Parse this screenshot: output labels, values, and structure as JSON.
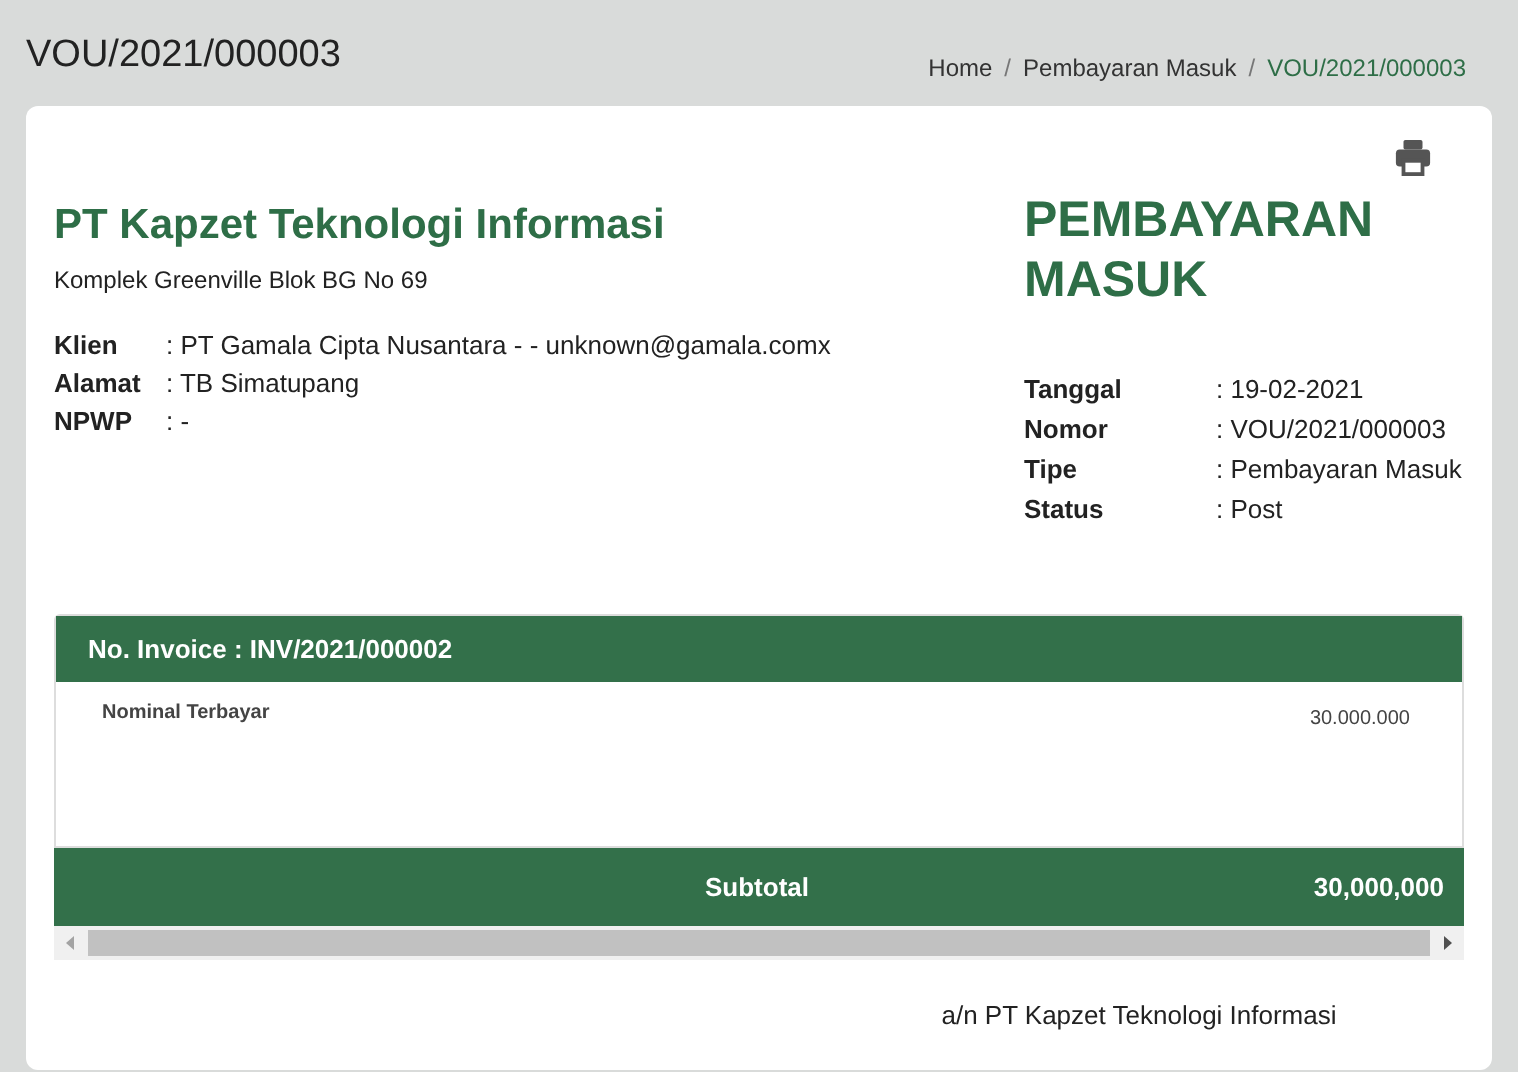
{
  "page_title": "VOU/2021/000003",
  "breadcrumb_separator": "/",
  "breadcrumb": [
    {
      "label": "Home",
      "selected": false
    },
    {
      "label": "Pembayaran Masuk",
      "selected": false
    },
    {
      "label": "VOU/2021/000003",
      "selected": true
    }
  ],
  "company": {
    "name": "PT Kapzet Teknologi Informasi",
    "address": "Komplek Greenville Blok BG No 69"
  },
  "client_fields": [
    {
      "label": "Klien",
      "value": ": PT Gamala Cipta Nusantara - - unknown@gamala.comx"
    },
    {
      "label": "Alamat",
      "value": ": TB Simatupang"
    },
    {
      "label": "NPWP",
      "value": ": -"
    }
  ],
  "document_title": "PEMBAYARAN MASUK",
  "document_fields": [
    {
      "label": "Tanggal",
      "value": ": 19-02-2021"
    },
    {
      "label": "Nomor",
      "value": ": VOU/2021/000003"
    },
    {
      "label": "Tipe",
      "value": ": Pembayaran Masuk"
    },
    {
      "label": "Status",
      "value": ": Post"
    }
  ],
  "invoice": {
    "header": "No. Invoice : INV/2021/000002",
    "rows": [
      {
        "label": "Nominal Terbayar",
        "amount": "30.000.000"
      }
    ],
    "subtotal_label": "Subtotal",
    "subtotal": "30,000,000"
  },
  "signature": "a/n PT Kapzet Teknologi Informasi"
}
